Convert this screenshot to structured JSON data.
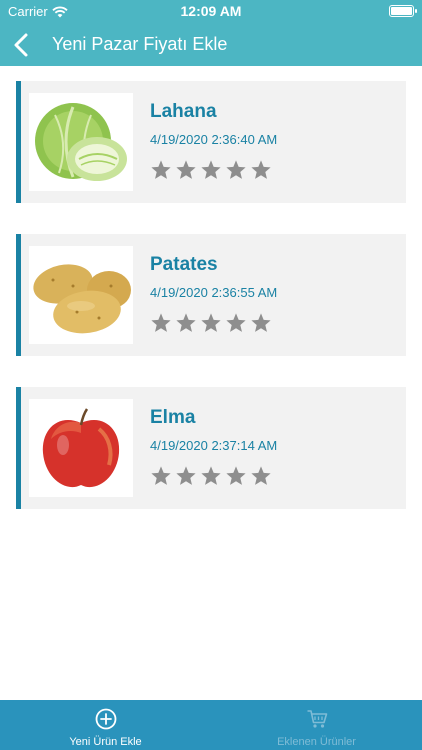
{
  "status_bar": {
    "carrier": "Carrier",
    "time": "12:09 AM"
  },
  "nav": {
    "title": "Yeni Pazar Fiyatı Ekle",
    "back_icon": "chevron-left-icon"
  },
  "colors": {
    "header": "#4cb6c3",
    "accent": "#1a82a4",
    "card_bg": "#f2f2f2",
    "tabbar": "#2a93bc",
    "star": "#8e8e8e"
  },
  "items": [
    {
      "name": "Lahana",
      "date": "4/19/2020 2:36:40 AM",
      "rating": 0,
      "image": "cabbage"
    },
    {
      "name": "Patates",
      "date": "4/19/2020 2:36:55 AM",
      "rating": 0,
      "image": "potato"
    },
    {
      "name": "Elma",
      "date": "4/19/2020 2:37:14 AM",
      "rating": 0,
      "image": "apple"
    }
  ],
  "tabs": [
    {
      "label": "Yeni Ürün Ekle",
      "icon": "plus-circle-icon",
      "active": true
    },
    {
      "label": "Eklenen Ürünler",
      "icon": "cart-icon",
      "active": false
    }
  ]
}
